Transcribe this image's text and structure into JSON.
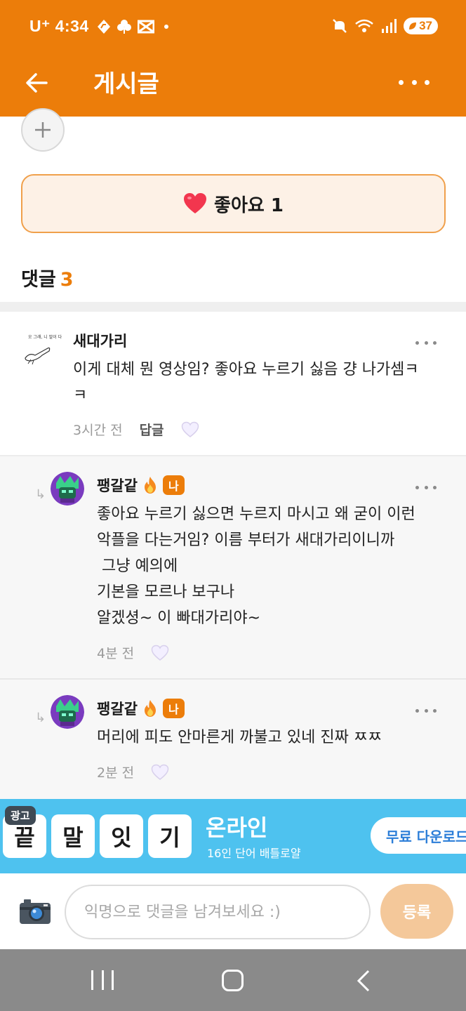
{
  "status_bar": {
    "carrier": "U⁺",
    "time": "4:34",
    "battery": "37"
  },
  "app_bar": {
    "title": "게시글"
  },
  "like": {
    "label": "좋아요 1",
    "heart": "❤"
  },
  "comments_header": {
    "label": "댓글",
    "count": "3"
  },
  "comments": [
    {
      "author": "새대가리",
      "avatar_caption": "오 그래, 니 말이 다 맞아",
      "text": "이게 대체 뭔 영상임? 좋아요 누르기 싫음 걍 나가셈ㅋ\nㅋ",
      "time": "3시간 전",
      "reply_label": "답글"
    },
    {
      "author": "팽갈같",
      "badge": "나",
      "text": "좋아요 누르기 싫으면 누르지 마시고 왜 굳이 이런\n악플을 다는거임? 이름 부터가 새대가리이니까\n 그냥 예의에\n기본을 모르나 보구나\n알겠셩~ 이 빠대가리야~",
      "time": "4분 전"
    },
    {
      "author": "팽갈같",
      "badge": "나",
      "text": "머리에 피도 안마른게 까불고 있네 진짜 ㅉㅉ",
      "time": "2분 전"
    }
  ],
  "ad": {
    "badge": "광고",
    "tiles": [
      "끝",
      "말",
      "잇",
      "기"
    ],
    "title": "온라인",
    "subtitle": "16인 단어 배틀로얄",
    "cta": "무료 다운로드"
  },
  "input_bar": {
    "placeholder": "익명으로 댓글을 남겨보세요 :)",
    "submit": "등록"
  },
  "colors": {
    "brand": "#ec7d0a",
    "ad_bg": "#4ec2ef",
    "submit_disabled": "#f4c89a"
  }
}
